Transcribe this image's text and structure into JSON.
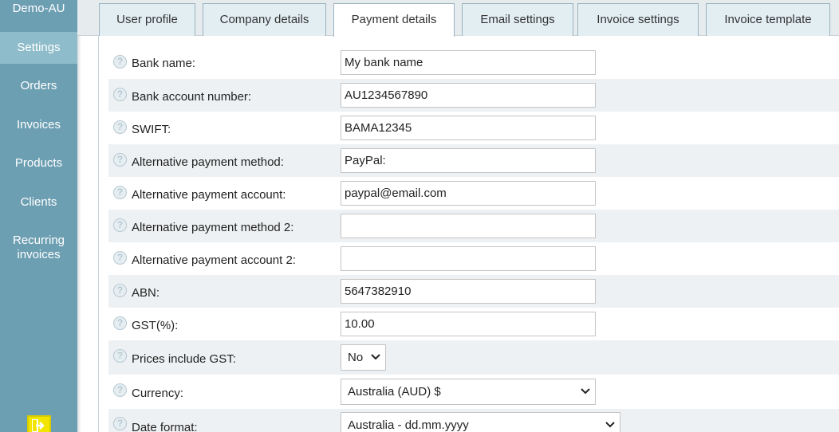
{
  "sidebar": {
    "brand": "Demo-AU",
    "items": [
      {
        "label": "Settings",
        "active": true
      },
      {
        "label": "Orders"
      },
      {
        "label": "Invoices"
      },
      {
        "label": "Products"
      },
      {
        "label": "Clients"
      },
      {
        "label": "Recurring invoices"
      }
    ],
    "logout_icon": "exit-arrow-icon"
  },
  "tabs": [
    {
      "label": "User profile"
    },
    {
      "label": "Company details"
    },
    {
      "label": "Payment details",
      "active": true
    },
    {
      "label": "Email settings"
    },
    {
      "label": "Invoice settings"
    },
    {
      "label": "Invoice template"
    }
  ],
  "form": {
    "help_icon": "question-circle-icon",
    "rows": [
      {
        "label": "Bank name:",
        "value": "My bank name"
      },
      {
        "label": "Bank account number:",
        "value": "AU1234567890"
      },
      {
        "label": "SWIFT:",
        "value": "BAMA12345"
      },
      {
        "label": "Alternative payment method:",
        "value": "PayPal:"
      },
      {
        "label": "Alternative payment account:",
        "value": "paypal@email.com"
      },
      {
        "label": "Alternative payment method 2:",
        "value": ""
      },
      {
        "label": "Alternative payment account 2:",
        "value": ""
      },
      {
        "label": "ABN:",
        "value": "5647382910"
      },
      {
        "label": "GST(%):",
        "value": "10.00"
      },
      {
        "label": "Prices include GST:",
        "value": "No"
      },
      {
        "label": "Currency:",
        "value": "Australia (AUD) $"
      },
      {
        "label": "Date format:",
        "value": "Australia - dd.mm.yyyy"
      }
    ]
  },
  "colors": {
    "sidebar": "#6d9fb2",
    "sidebar_active": "#8ebccb",
    "tab_bg": "#e3eef3",
    "row_shade": "#eef1f3"
  }
}
